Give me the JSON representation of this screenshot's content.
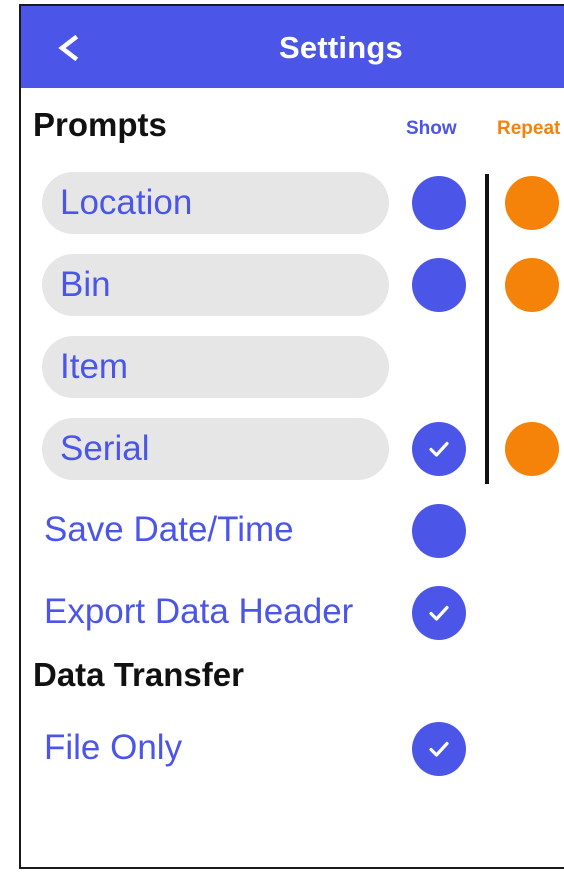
{
  "header": {
    "back_glyph": "<",
    "title": "Settings"
  },
  "prompts": {
    "heading": "Prompts",
    "show_label": "Show",
    "repeat_label": "Repeat",
    "items": [
      {
        "label": "Location",
        "show": "filled",
        "repeat": "filled"
      },
      {
        "label": "Bin",
        "show": "filled",
        "repeat": "filled"
      },
      {
        "label": "Item",
        "show": "none",
        "repeat": "none"
      },
      {
        "label": "Serial",
        "show": "checked",
        "repeat": "filled"
      }
    ]
  },
  "options": [
    {
      "label": "Save Date/Time",
      "state": "filled"
    },
    {
      "label": "Export Data Header",
      "state": "checked"
    }
  ],
  "data_transfer": {
    "heading": "Data Transfer",
    "items": [
      {
        "label": "File Only",
        "state": "checked"
      }
    ]
  },
  "colors": {
    "accent": "#4b56e8",
    "repeat": "#f5830a",
    "pill_bg": "#e6e6e6"
  }
}
